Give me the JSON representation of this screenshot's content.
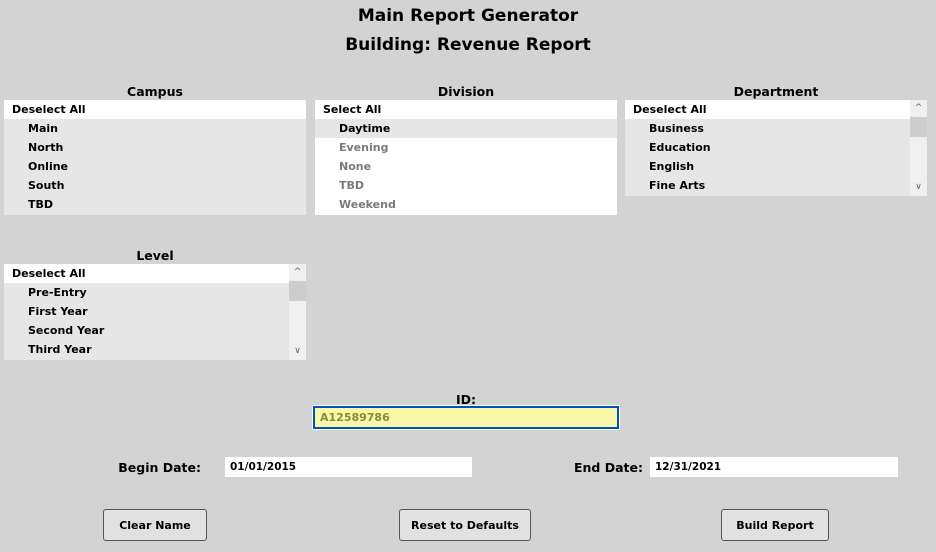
{
  "header": {
    "title": "Main Report Generator",
    "subtitle": "Building: Revenue Report"
  },
  "campus": {
    "label": "Campus",
    "toggle": "Deselect All",
    "items": [
      "Main",
      "North",
      "Online",
      "South",
      "TBD"
    ]
  },
  "division": {
    "label": "Division",
    "toggle": "Select All",
    "items": [
      "Daytime",
      "Evening",
      "None",
      "TBD",
      "Weekend"
    ]
  },
  "department": {
    "label": "Department",
    "toggle": "Deselect All",
    "items": [
      "Business",
      "Education",
      "English",
      "Fine Arts"
    ]
  },
  "level": {
    "label": "Level",
    "toggle": "Deselect All",
    "items": [
      "Pre-Entry",
      "First Year",
      "Second Year",
      "Third Year"
    ]
  },
  "id": {
    "label": "ID:",
    "value": "A12589786"
  },
  "dates": {
    "begin_label": "Begin Date:",
    "begin_value": "01/01/2015",
    "end_label": "End Date:",
    "end_value": "12/31/2021"
  },
  "buttons": {
    "clear": "Clear Name",
    "reset": "Reset to Defaults",
    "build": "Build Report"
  },
  "colors": {
    "id_bg": "#f8f8a8",
    "id_border": "#0050c0",
    "id_text": "#8a8a3a"
  }
}
